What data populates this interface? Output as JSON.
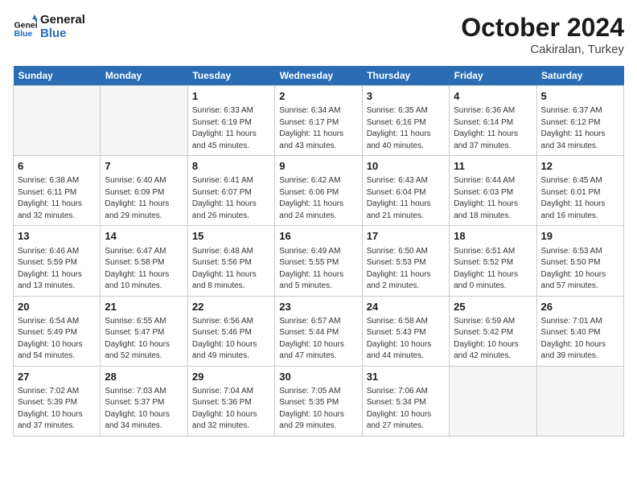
{
  "header": {
    "logo_line1": "General",
    "logo_line2": "Blue",
    "title": "October 2024",
    "subtitle": "Cakiralan, Turkey"
  },
  "weekdays": [
    "Sunday",
    "Monday",
    "Tuesday",
    "Wednesday",
    "Thursday",
    "Friday",
    "Saturday"
  ],
  "weeks": [
    [
      {
        "day": "",
        "info": ""
      },
      {
        "day": "",
        "info": ""
      },
      {
        "day": "1",
        "info": "Sunrise: 6:33 AM\nSunset: 6:19 PM\nDaylight: 11 hours and 45 minutes."
      },
      {
        "day": "2",
        "info": "Sunrise: 6:34 AM\nSunset: 6:17 PM\nDaylight: 11 hours and 43 minutes."
      },
      {
        "day": "3",
        "info": "Sunrise: 6:35 AM\nSunset: 6:16 PM\nDaylight: 11 hours and 40 minutes."
      },
      {
        "day": "4",
        "info": "Sunrise: 6:36 AM\nSunset: 6:14 PM\nDaylight: 11 hours and 37 minutes."
      },
      {
        "day": "5",
        "info": "Sunrise: 6:37 AM\nSunset: 6:12 PM\nDaylight: 11 hours and 34 minutes."
      }
    ],
    [
      {
        "day": "6",
        "info": "Sunrise: 6:38 AM\nSunset: 6:11 PM\nDaylight: 11 hours and 32 minutes."
      },
      {
        "day": "7",
        "info": "Sunrise: 6:40 AM\nSunset: 6:09 PM\nDaylight: 11 hours and 29 minutes."
      },
      {
        "day": "8",
        "info": "Sunrise: 6:41 AM\nSunset: 6:07 PM\nDaylight: 11 hours and 26 minutes."
      },
      {
        "day": "9",
        "info": "Sunrise: 6:42 AM\nSunset: 6:06 PM\nDaylight: 11 hours and 24 minutes."
      },
      {
        "day": "10",
        "info": "Sunrise: 6:43 AM\nSunset: 6:04 PM\nDaylight: 11 hours and 21 minutes."
      },
      {
        "day": "11",
        "info": "Sunrise: 6:44 AM\nSunset: 6:03 PM\nDaylight: 11 hours and 18 minutes."
      },
      {
        "day": "12",
        "info": "Sunrise: 6:45 AM\nSunset: 6:01 PM\nDaylight: 11 hours and 16 minutes."
      }
    ],
    [
      {
        "day": "13",
        "info": "Sunrise: 6:46 AM\nSunset: 5:59 PM\nDaylight: 11 hours and 13 minutes."
      },
      {
        "day": "14",
        "info": "Sunrise: 6:47 AM\nSunset: 5:58 PM\nDaylight: 11 hours and 10 minutes."
      },
      {
        "day": "15",
        "info": "Sunrise: 6:48 AM\nSunset: 5:56 PM\nDaylight: 11 hours and 8 minutes."
      },
      {
        "day": "16",
        "info": "Sunrise: 6:49 AM\nSunset: 5:55 PM\nDaylight: 11 hours and 5 minutes."
      },
      {
        "day": "17",
        "info": "Sunrise: 6:50 AM\nSunset: 5:53 PM\nDaylight: 11 hours and 2 minutes."
      },
      {
        "day": "18",
        "info": "Sunrise: 6:51 AM\nSunset: 5:52 PM\nDaylight: 11 hours and 0 minutes."
      },
      {
        "day": "19",
        "info": "Sunrise: 6:53 AM\nSunset: 5:50 PM\nDaylight: 10 hours and 57 minutes."
      }
    ],
    [
      {
        "day": "20",
        "info": "Sunrise: 6:54 AM\nSunset: 5:49 PM\nDaylight: 10 hours and 54 minutes."
      },
      {
        "day": "21",
        "info": "Sunrise: 6:55 AM\nSunset: 5:47 PM\nDaylight: 10 hours and 52 minutes."
      },
      {
        "day": "22",
        "info": "Sunrise: 6:56 AM\nSunset: 5:46 PM\nDaylight: 10 hours and 49 minutes."
      },
      {
        "day": "23",
        "info": "Sunrise: 6:57 AM\nSunset: 5:44 PM\nDaylight: 10 hours and 47 minutes."
      },
      {
        "day": "24",
        "info": "Sunrise: 6:58 AM\nSunset: 5:43 PM\nDaylight: 10 hours and 44 minutes."
      },
      {
        "day": "25",
        "info": "Sunrise: 6:59 AM\nSunset: 5:42 PM\nDaylight: 10 hours and 42 minutes."
      },
      {
        "day": "26",
        "info": "Sunrise: 7:01 AM\nSunset: 5:40 PM\nDaylight: 10 hours and 39 minutes."
      }
    ],
    [
      {
        "day": "27",
        "info": "Sunrise: 7:02 AM\nSunset: 5:39 PM\nDaylight: 10 hours and 37 minutes."
      },
      {
        "day": "28",
        "info": "Sunrise: 7:03 AM\nSunset: 5:37 PM\nDaylight: 10 hours and 34 minutes."
      },
      {
        "day": "29",
        "info": "Sunrise: 7:04 AM\nSunset: 5:36 PM\nDaylight: 10 hours and 32 minutes."
      },
      {
        "day": "30",
        "info": "Sunrise: 7:05 AM\nSunset: 5:35 PM\nDaylight: 10 hours and 29 minutes."
      },
      {
        "day": "31",
        "info": "Sunrise: 7:06 AM\nSunset: 5:34 PM\nDaylight: 10 hours and 27 minutes."
      },
      {
        "day": "",
        "info": ""
      },
      {
        "day": "",
        "info": ""
      }
    ]
  ]
}
